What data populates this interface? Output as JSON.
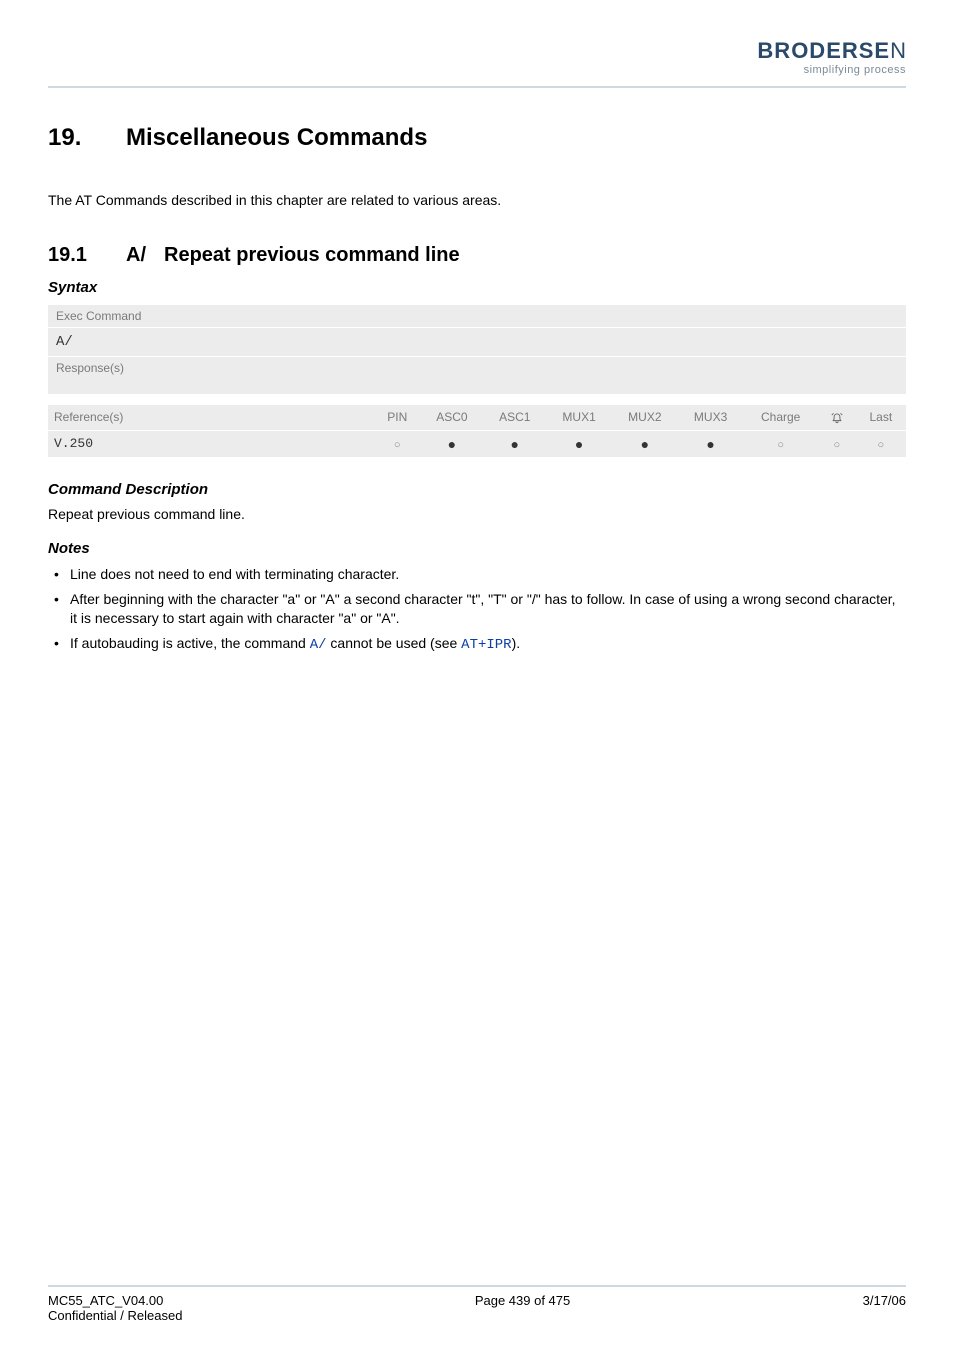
{
  "logo": {
    "brand_bold": "BRODERSE",
    "brand_thin": "N",
    "tagline": "simplifying process"
  },
  "section": {
    "number": "19.",
    "title": "Miscellaneous Commands"
  },
  "intro": "The AT Commands described in this chapter are related to various areas.",
  "subsection": {
    "number": "19.1",
    "command": "A/",
    "title": "Repeat previous command line"
  },
  "syntax": {
    "label": "Syntax",
    "exec_label": "Exec Command",
    "exec_value": "A/",
    "response_label": "Response(s)"
  },
  "reference": {
    "headers": {
      "ref": "Reference(s)",
      "pin": "PIN",
      "asc0": "ASC0",
      "asc1": "ASC1",
      "mux1": "MUX1",
      "mux2": "MUX2",
      "mux3": "MUX3",
      "charge": "Charge",
      "bell": "bell-icon",
      "last": "Last"
    },
    "row": {
      "ref": "V.250",
      "pin": "open",
      "asc0": "filled",
      "asc1": "filled",
      "mux1": "filled",
      "mux2": "filled",
      "mux3": "filled",
      "charge": "open",
      "bell": "open",
      "last": "open"
    }
  },
  "command_description": {
    "label": "Command Description",
    "text": "Repeat previous command line."
  },
  "notes": {
    "label": "Notes",
    "items": [
      {
        "pre": "Line does not need to end with terminating character."
      },
      {
        "pre": "After beginning with the character \"a\" or \"A\" a second character \"t\", \"T\" or \"/\" has to follow. In case of using a wrong second character, it is necessary to start again with character \"a\" or \"A\"."
      },
      {
        "pre": "If autobauding is active, the command ",
        "link1": "A/",
        "mid": " cannot be used (see ",
        "link2": "AT+IPR",
        "post": ")."
      }
    ]
  },
  "footer": {
    "left1": "MC55_ATC_V04.00",
    "left2": "Confidential / Released",
    "center": "Page 439 of 475",
    "right": "3/17/06"
  },
  "glyphs": {
    "filled": "●",
    "open": "○"
  }
}
